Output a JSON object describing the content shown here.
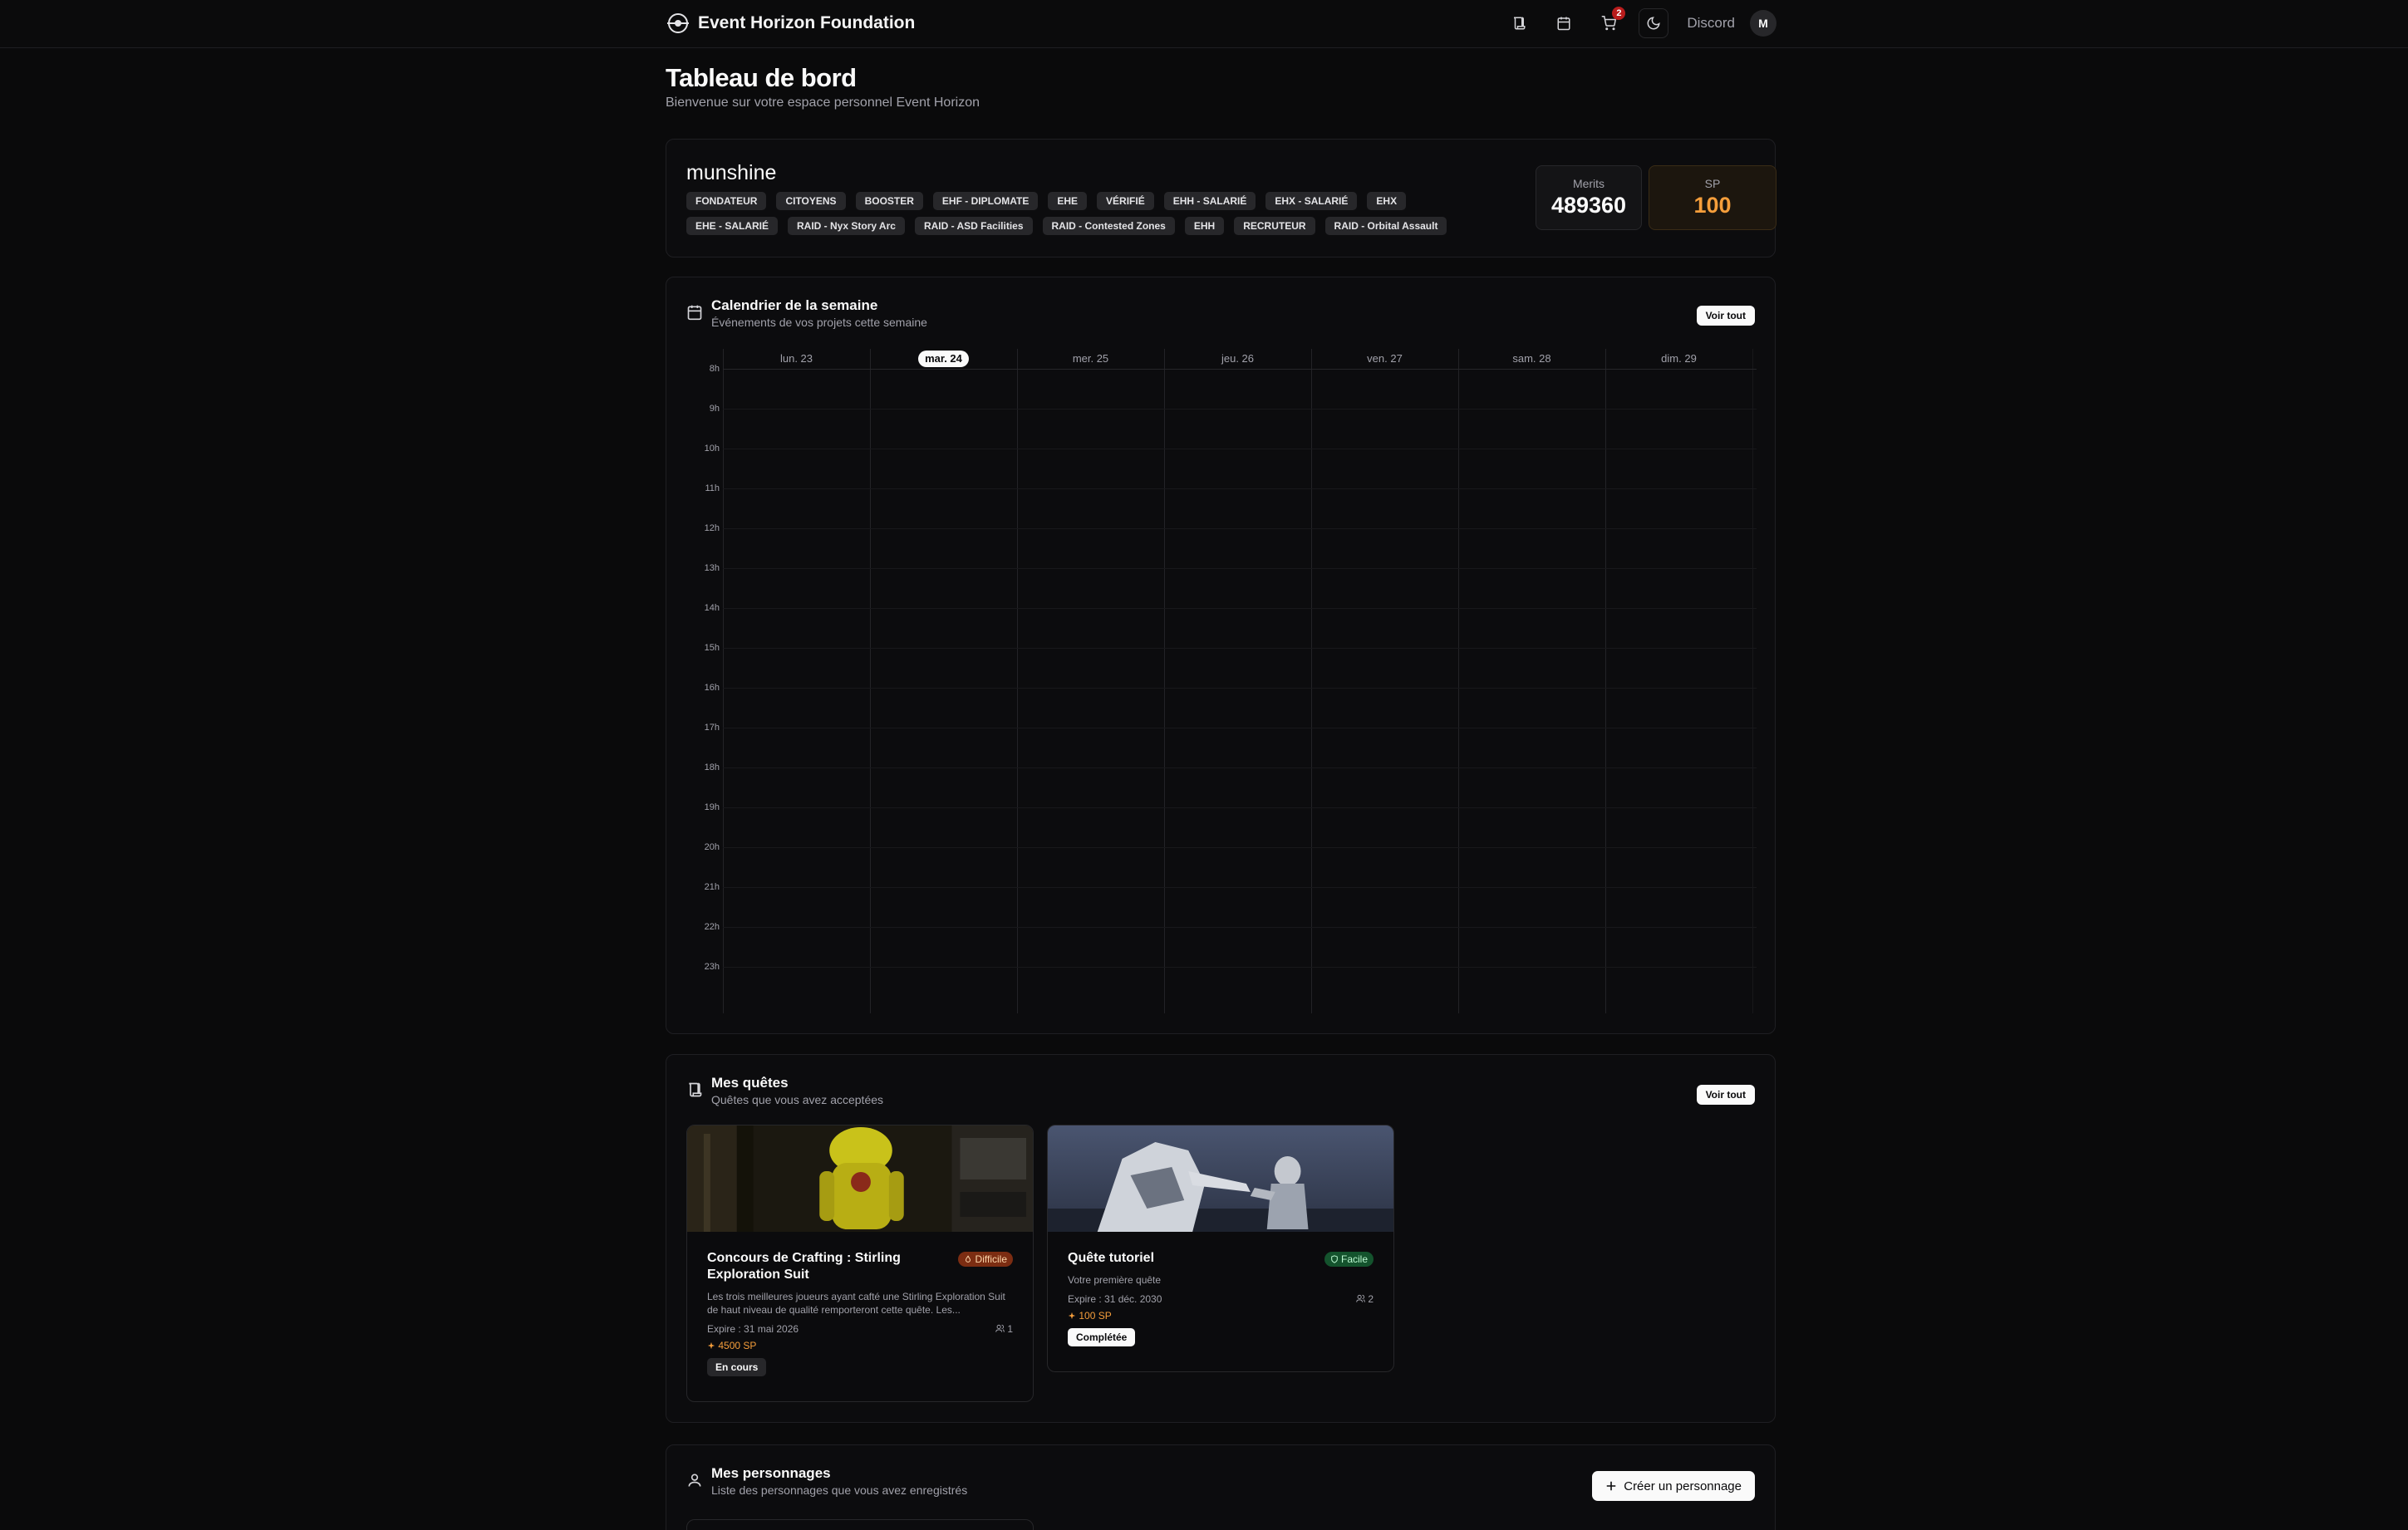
{
  "header": {
    "brand": "Event Horizon Foundation",
    "cart_count": "2",
    "discord": "Discord",
    "avatar_initial": "M"
  },
  "page": {
    "title": "Tableau de bord",
    "subtitle": "Bienvenue sur votre espace personnel Event Horizon"
  },
  "profile": {
    "username": "munshine",
    "roles": [
      "FONDATEUR",
      "CITOYENS",
      "BOOSTER",
      "EHF - DIPLOMATE",
      "EHE",
      "VÉRIFIÉ",
      "EHH - SALARIÉ",
      "EHX - SALARIÉ",
      "EHX",
      "EHE - SALARIÉ",
      "RAID - Nyx Story Arc",
      "RAID - ASD Facilities",
      "RAID - Contested Zones",
      "EHH",
      "RECRUTEUR",
      "RAID - Orbital Assault"
    ],
    "merits_label": "Merits",
    "merits_value": "489360",
    "sp_label": "SP",
    "sp_value": "100"
  },
  "calendar": {
    "title": "Calendrier de la semaine",
    "subtitle": "Événements de vos projets cette semaine",
    "view_all": "Voir tout",
    "days": [
      "lun. 23",
      "mar. 24",
      "mer. 25",
      "jeu. 26",
      "ven. 27",
      "sam. 28",
      "dim. 29"
    ],
    "today_index": 1,
    "hours": [
      "8h",
      "9h",
      "10h",
      "11h",
      "12h",
      "13h",
      "14h",
      "15h",
      "16h",
      "17h",
      "18h",
      "19h",
      "20h",
      "21h",
      "22h",
      "23h"
    ]
  },
  "quests": {
    "title": "Mes quêtes",
    "subtitle": "Quêtes que vous avez acceptées",
    "view_all": "Voir tout",
    "items": [
      {
        "title": "Concours de Crafting : Stirling Exploration Suit",
        "difficulty": "Difficile",
        "description": "Les trois meilleures joueurs ayant cafté une Stirling Exploration Suit de haut niveau de qualité remporteront cette quête. Les...",
        "expires": "Expire : 31 mai 2026",
        "participants": "1",
        "reward": "4500 SP",
        "status": "En cours"
      },
      {
        "title": "Quête tutoriel",
        "difficulty": "Facile",
        "description": "Votre première quête",
        "expires": "Expire : 31 déc. 2030",
        "participants": "2",
        "reward": "100 SP",
        "status": "Complétée"
      }
    ]
  },
  "characters": {
    "title": "Mes personnages",
    "subtitle": "Liste des personnages que vous avez enregistrés",
    "create": "Créer un personnage"
  }
}
